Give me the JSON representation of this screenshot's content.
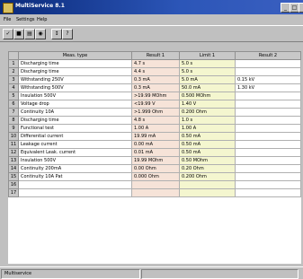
{
  "window": {
    "title": "MultiService 8.1",
    "min": "_",
    "max": "□",
    "close": "×"
  },
  "menu": [
    "File",
    "Settings",
    "Help"
  ],
  "toolbar": {
    "icons": [
      "new-icon",
      "save-icon",
      "print-icon",
      "preview-icon",
      "settings-icon",
      "help-icon"
    ]
  },
  "table": {
    "headers": [
      "",
      "Meas. type",
      "Result 1",
      "Limit 1",
      "Result 2"
    ],
    "rows": [
      {
        "n": "1",
        "type": "Discharging time",
        "r1": "4.7 s",
        "l1": "5.0 s",
        "r2": ""
      },
      {
        "n": "2",
        "type": "Discharging time",
        "r1": "4.4 s",
        "l1": "5.0 s",
        "r2": ""
      },
      {
        "n": "3",
        "type": "Withstanding 250V",
        "r1": "0.3 mA",
        "l1": "5.0 mA",
        "r2": "0.15 kV"
      },
      {
        "n": "4",
        "type": "Withstanding 500V",
        "r1": "0.3 mA",
        "l1": "50.0 mA",
        "r2": "1.30 kV"
      },
      {
        "n": "5",
        "type": "Insulation 500V",
        "r1": ">19.99 MOhm",
        "l1": "0.500 MOhm",
        "r2": ""
      },
      {
        "n": "6",
        "type": "Voltage drop",
        "r1": "<19.99 V",
        "l1": "1.40 V",
        "r2": ""
      },
      {
        "n": "7",
        "type": "Continuity 10A",
        "r1": ">1.999 Ohm",
        "l1": "0.200 Ohm",
        "r2": ""
      },
      {
        "n": "8",
        "type": "Discharging time",
        "r1": "4.8 s",
        "l1": "1.0 s",
        "r2": ""
      },
      {
        "n": "9",
        "type": "Functional test",
        "r1": "1.00 A",
        "l1": "1.00 A",
        "r2": ""
      },
      {
        "n": "10",
        "type": "Differential current",
        "r1": "19.99 mA",
        "l1": "0.50 mA",
        "r2": ""
      },
      {
        "n": "11",
        "type": "Leakage current",
        "r1": "0.00 mA",
        "l1": "0.50 mA",
        "r2": ""
      },
      {
        "n": "12",
        "type": "Equivalent Leak. current",
        "r1": "0.01 mA",
        "l1": "0.50 mA",
        "r2": ""
      },
      {
        "n": "13",
        "type": "Insulation 500V",
        "r1": "19.99 MOhm",
        "l1": "0.50 MOhm",
        "r2": ""
      },
      {
        "n": "14",
        "type": "Continuity 200mA",
        "r1": "0.00 Ohm",
        "l1": "0.20 Ohm",
        "r2": ""
      },
      {
        "n": "15",
        "type": "Continuity 10A Pat",
        "r1": "0.000 Ohm",
        "l1": "0.200 Ohm",
        "r2": ""
      },
      {
        "n": "16",
        "type": "",
        "r1": "",
        "l1": "",
        "r2": ""
      },
      {
        "n": "17",
        "type": "",
        "r1": "",
        "l1": "",
        "r2": ""
      }
    ]
  },
  "status": {
    "left": "Multiservice"
  }
}
